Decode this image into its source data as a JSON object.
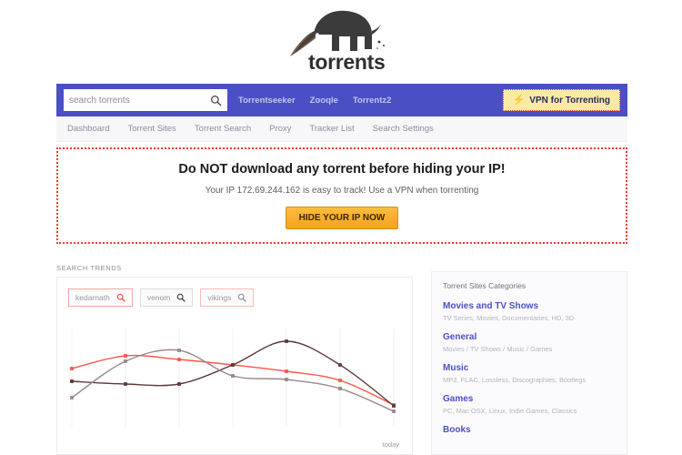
{
  "logo": {
    "text": "torrents",
    "icon": "anteater-logo"
  },
  "topbar": {
    "search": {
      "placeholder": "search torrents",
      "value": "",
      "icon": "search-icon"
    },
    "links": [
      {
        "label": "Torrentseeker"
      },
      {
        "label": "Zooqle"
      },
      {
        "label": "Torrentz2"
      }
    ],
    "vpn_button": {
      "label": "VPN for Torrenting",
      "icon": "bolt-icon"
    },
    "colors": {
      "bar": "#4b4fc4",
      "vpn_bg": "#fbe9a7",
      "vpn_border": "#e2342e"
    }
  },
  "subnav": {
    "items": [
      {
        "label": "Dashboard"
      },
      {
        "label": "Torrent Sites"
      },
      {
        "label": "Torrent Search"
      },
      {
        "label": "Proxy"
      },
      {
        "label": "Tracker List"
      },
      {
        "label": "Search Settings"
      }
    ]
  },
  "warning": {
    "title": "Do NOT download any torrent before hiding your IP!",
    "subtitle": "Your IP 172.69.244.162 is easy to track! Use a VPN when torrenting",
    "ip": "172.69.244.162",
    "button_label": "HIDE YOUR IP NOW",
    "border_color": "#f23b32",
    "button_color": "#f5a21c"
  },
  "trends": {
    "section_label": "SEARCH TRENDS",
    "chips": [
      {
        "label": "kedarnath",
        "icon": "search-icon",
        "color": "#f9564a"
      },
      {
        "label": "venom",
        "icon": "search-icon",
        "color": "#5d3a3a"
      },
      {
        "label": "vikings",
        "icon": "search-icon",
        "color": "#9b8789"
      }
    ],
    "today_label": "today"
  },
  "chart_data": {
    "type": "line",
    "title": "SEARCH TRENDS",
    "xlabel": "",
    "ylabel": "",
    "grid": true,
    "legend": "none",
    "x": [
      0,
      1,
      2,
      3,
      4,
      5,
      6
    ],
    "tick_labels": [
      "",
      "",
      "",
      "",
      "",
      "",
      "today"
    ],
    "ylim": [
      0,
      100
    ],
    "series": [
      {
        "name": "kedarnath",
        "color": "#f9564a",
        "values": [
          58,
          72,
          68,
          62,
          55,
          45,
          18
        ]
      },
      {
        "name": "venom",
        "color": "#5d3a3a",
        "values": [
          44,
          41,
          41,
          62,
          88,
          62,
          17
        ]
      },
      {
        "name": "vikings",
        "color": "#9b8789",
        "values": [
          26,
          66,
          78,
          50,
          46,
          36,
          11
        ]
      }
    ]
  },
  "sidebar": {
    "title": "Torrent Sites Categories",
    "categories": [
      {
        "name": "Movies and TV Shows",
        "sub": "TV Series, Movies, Documentaries, HD, 3D"
      },
      {
        "name": "General",
        "sub": "Movies / TV Shows / Music / Games"
      },
      {
        "name": "Music",
        "sub": "MP3, FLAC, Lossless, Discographies, Bootlegs"
      },
      {
        "name": "Games",
        "sub": "PC, Mac OSX, Linux, Indie Games, Classics"
      },
      {
        "name": "Books",
        "sub": ""
      }
    ],
    "link_color": "#4b4fc4"
  }
}
